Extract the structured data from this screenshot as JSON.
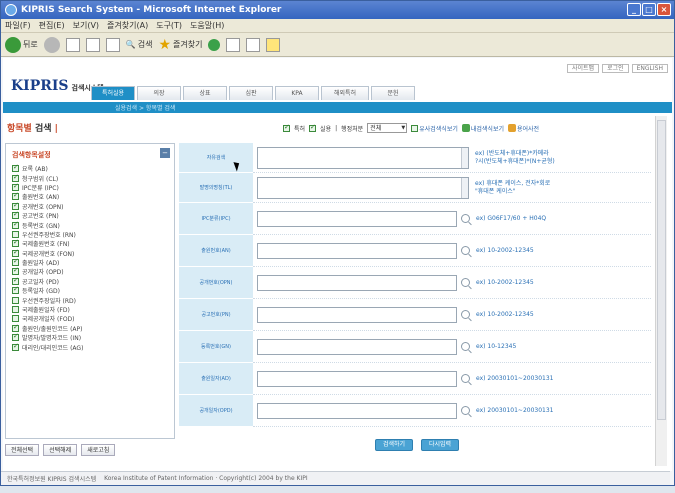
{
  "window": {
    "title": "KIPRIS Search System - Microsoft Internet Explorer",
    "buttons": [
      "_",
      "□",
      "×"
    ]
  },
  "menu": [
    "파일(F)",
    "편집(E)",
    "보기(V)",
    "즐겨찾기(A)",
    "도구(T)",
    "도움말(H)"
  ],
  "toolbar": {
    "back_label": "뒤로",
    "search_label": "검색",
    "favorites_label": "즐겨찾기"
  },
  "site": {
    "logo": "KIPRIS",
    "logo_sub": "검색시스템",
    "top_links": [
      "사이트맵",
      "로그인",
      "ENGLISH"
    ],
    "nav_tabs": [
      "특허실용",
      "의장",
      "상표",
      "심판",
      "KPA",
      "해외특허",
      "문헌"
    ],
    "breadcrumb": "실용검색 > 항목별 검색"
  },
  "page": {
    "title_part1": "항목별",
    "title_part2": "검색",
    "options": {
      "patent_label": "특허",
      "utility_label": "실용",
      "status_label": "행정처분",
      "status_value": "전체",
      "link_similar": "유사검색식보기",
      "link_myterms": "내검색식보기",
      "link_dictionary": "용어사전"
    }
  },
  "sidebar": {
    "title": "검색항목설정",
    "toggle": "−",
    "fields": [
      {
        "label": "요록 (AB)",
        "checked": true
      },
      {
        "label": "청구범위 (CL)",
        "checked": true
      },
      {
        "label": "IPC분류 (IPC)",
        "checked": true
      },
      {
        "label": "출원번호 (AN)",
        "checked": true
      },
      {
        "label": "공개번호 (OPN)",
        "checked": true
      },
      {
        "label": "공고번호 (PN)",
        "checked": true
      },
      {
        "label": "등록번호 (GN)",
        "checked": true
      },
      {
        "label": "우선권주장번호 (RN)",
        "checked": false
      },
      {
        "label": "국제출원번호 (FN)",
        "checked": true
      },
      {
        "label": "국제공개번호 (FON)",
        "checked": true
      },
      {
        "label": "출원일자 (AD)",
        "checked": true
      },
      {
        "label": "공개일자 (OPD)",
        "checked": true
      },
      {
        "label": "공고일자 (PD)",
        "checked": true
      },
      {
        "label": "등록일자 (GD)",
        "checked": true
      },
      {
        "label": "우선권주장일자 (RD)",
        "checked": false
      },
      {
        "label": "국제출원일자 (FD)",
        "checked": false
      },
      {
        "label": "국제공개일자 (FOD)",
        "checked": false
      },
      {
        "label": "출원인/출원인코드 (AP)",
        "checked": true
      },
      {
        "label": "발명자/발명자코드 (IN)",
        "checked": true
      },
      {
        "label": "대리인/대리인코드 (AG)",
        "checked": true
      }
    ],
    "buttons": [
      "전체선택",
      "선택해제",
      "새로고침"
    ]
  },
  "form": {
    "rows": [
      {
        "label": "자유검색",
        "type": "textarea",
        "example": "ex) (반도체+휴대폰)*카메라",
        "example2": "?시(반도체+휴대폰)*(N+균형)"
      },
      {
        "label": "발명의명칭(TL)",
        "type": "textarea",
        "example": "ex) 휴대폰 케이스, 전자*회로",
        "example2": "\"휴대폰 케이스\""
      },
      {
        "label": "IPC분류(IPC)",
        "type": "input",
        "example": "ex) G06F17/60 + H04Q"
      },
      {
        "label": "출원번호(AN)",
        "type": "input",
        "example": "ex) 10-2002-12345"
      },
      {
        "label": "공개번호(OPN)",
        "type": "input",
        "example": "ex) 10-2002-12345"
      },
      {
        "label": "공고번호(PN)",
        "type": "input",
        "example": "ex) 10-2002-12345"
      },
      {
        "label": "등록번호(GN)",
        "type": "input",
        "example": "ex) 10-12345"
      },
      {
        "label": "출원일자(AD)",
        "type": "input",
        "example": "ex) 20030101~20030131"
      },
      {
        "label": "공개일자(OPD)",
        "type": "input",
        "example": "ex) 20030101~20030131"
      }
    ],
    "search_button": "검색하기",
    "reset_button": "다시입력"
  },
  "footer": {
    "org": "한국특허정보원 KIPRIS 검색시스템",
    "copyright": "Korea Institute of Patent Information · Copyright(c) 2004 by the KIPI"
  }
}
